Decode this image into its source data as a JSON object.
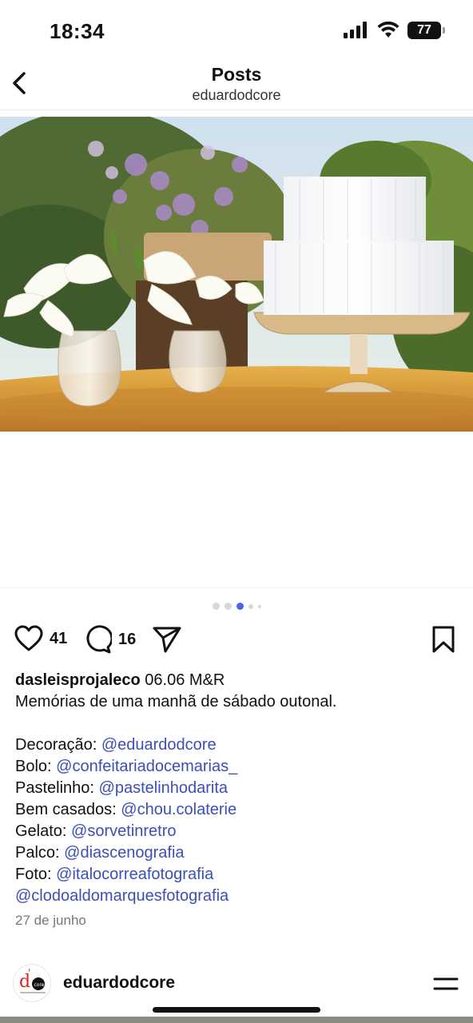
{
  "status_bar": {
    "time": "18:34",
    "battery": "77"
  },
  "header": {
    "title": "Posts",
    "subtitle": "eduardodcore"
  },
  "carousel": {
    "total_dots": 5,
    "active_index": 2
  },
  "actions": {
    "likes": "41",
    "comments": "16"
  },
  "caption": {
    "username": "dasleisprojaleco",
    "headline": " 06.06 M&R",
    "line2": "Memórias de uma manhã de sábado outonal.",
    "credits": [
      {
        "label": "Decoração: ",
        "mention": "@eduardodcore"
      },
      {
        "label": "Bolo: ",
        "mention": "@confeitariadocemarias_"
      },
      {
        "label": "Pastelinho: ",
        "mention": "@pastelinhodarita"
      },
      {
        "label": "Bem casados: ",
        "mention": "@chou.colaterie"
      },
      {
        "label": "Gelato: ",
        "mention": "@sorvetinretro"
      },
      {
        "label": "Palco: ",
        "mention": "@diascenografia"
      },
      {
        "label": "Foto: ",
        "mention": "@italocorreafotografia"
      }
    ],
    "last_mention": "@clodoaldomarquesfotografia"
  },
  "date": "27 de junho",
  "footer": {
    "account_name": "eduardodcore",
    "avatar_text": "d'core",
    "avatar_sub": "PRODUÇÃO & CENOGRAFIA"
  },
  "colors": {
    "mention": "#3b4fb8",
    "active_dot": "#4a66e8",
    "background": "#ffffff"
  },
  "icons": {
    "back": "chevron-left-icon",
    "like": "heart-icon",
    "comment": "comment-bubble-icon",
    "share": "send-icon",
    "save": "bookmark-icon",
    "menu": "menu-icon"
  }
}
